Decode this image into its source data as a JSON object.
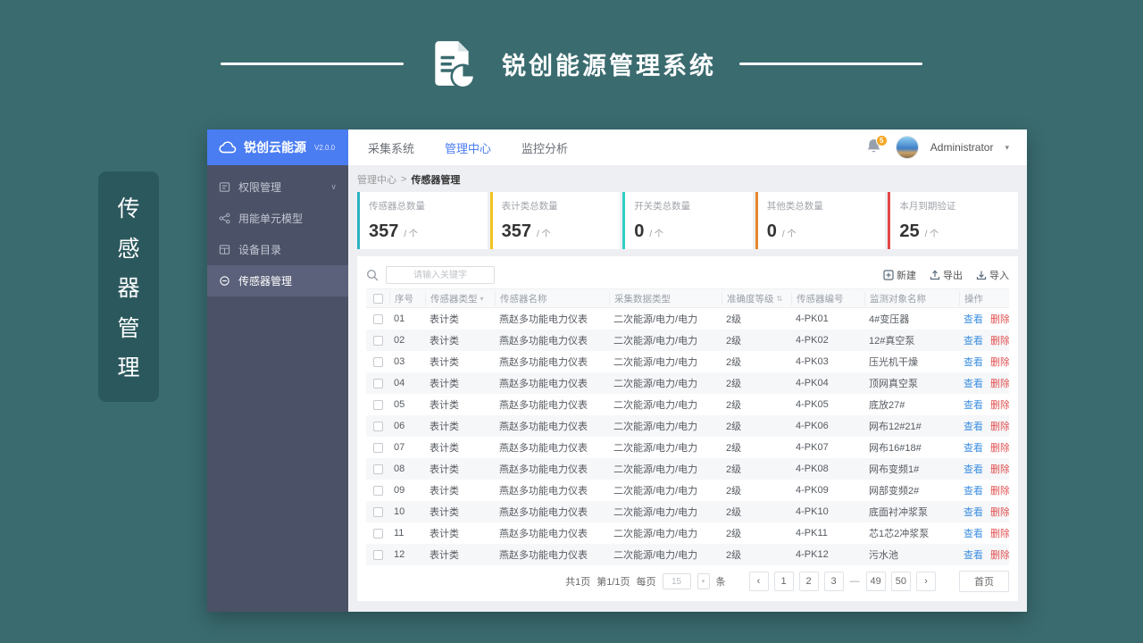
{
  "banner": {
    "title": "锐创能源管理系统"
  },
  "vertical_label": {
    "text": "传感器管理",
    "chars": [
      "传",
      "感",
      "器",
      "管",
      "理"
    ]
  },
  "sidebar": {
    "logo_text": "锐创云能源",
    "version": "V2.0.0",
    "items": [
      {
        "label": "权限管理",
        "active": false,
        "expandable": true
      },
      {
        "label": "用能单元模型",
        "active": false,
        "expandable": false
      },
      {
        "label": "设备目录",
        "active": false,
        "expandable": false
      },
      {
        "label": "传感器管理",
        "active": true,
        "expandable": false
      }
    ]
  },
  "topnav": {
    "items": [
      {
        "label": "采集系统",
        "active": false
      },
      {
        "label": "管理中心",
        "active": true
      },
      {
        "label": "监控分析",
        "active": false
      }
    ],
    "notification_badge": "5",
    "username": "Administrator"
  },
  "breadcrumb": {
    "parent": "管理中心",
    "separator": ">",
    "current": "传感器管理"
  },
  "stats": [
    {
      "label": "传感器总数量",
      "value": "357",
      "unit": "/ 个",
      "color": "#2bb3c0"
    },
    {
      "label": "表计类总数量",
      "value": "357",
      "unit": "/ 个",
      "color": "#f2c41d"
    },
    {
      "label": "开关类总数量",
      "value": "0",
      "unit": "/ 个",
      "color": "#2fd0c6"
    },
    {
      "label": "其他类总数量",
      "value": "0",
      "unit": "/ 个",
      "color": "#e6882e"
    },
    {
      "label": "本月到期验证",
      "value": "25",
      "unit": "/ 个",
      "color": "#e14848"
    }
  ],
  "toolbar": {
    "search_placeholder": "请输入关键字",
    "new_label": "新建",
    "export_label": "导出",
    "import_label": "导入"
  },
  "table": {
    "columns": [
      {
        "label": "序号"
      },
      {
        "label": "传感器类型",
        "icon": "filter"
      },
      {
        "label": "传感器名称"
      },
      {
        "label": "采集数据类型"
      },
      {
        "label": "准确度等级",
        "icon": "sort"
      },
      {
        "label": "传感器编号"
      },
      {
        "label": "监测对象名称"
      },
      {
        "label": "操作"
      }
    ],
    "actions": {
      "view": "查看",
      "delete": "删除"
    },
    "rows": [
      {
        "no": "01",
        "type": "表计类",
        "name": "燕赵多功能电力仪表",
        "data_type": "二次能源/电力/电力",
        "accuracy": "2级",
        "code": "4-PK01",
        "target": "4#变压器"
      },
      {
        "no": "02",
        "type": "表计类",
        "name": "燕赵多功能电力仪表",
        "data_type": "二次能源/电力/电力",
        "accuracy": "2级",
        "code": "4-PK02",
        "target": "12#真空泵"
      },
      {
        "no": "03",
        "type": "表计类",
        "name": "燕赵多功能电力仪表",
        "data_type": "二次能源/电力/电力",
        "accuracy": "2级",
        "code": "4-PK03",
        "target": "压光机干燥"
      },
      {
        "no": "04",
        "type": "表计类",
        "name": "燕赵多功能电力仪表",
        "data_type": "二次能源/电力/电力",
        "accuracy": "2级",
        "code": "4-PK04",
        "target": "顶网真空泵"
      },
      {
        "no": "05",
        "type": "表计类",
        "name": "燕赵多功能电力仪表",
        "data_type": "二次能源/电力/电力",
        "accuracy": "2级",
        "code": "4-PK05",
        "target": "底放27#"
      },
      {
        "no": "06",
        "type": "表计类",
        "name": "燕赵多功能电力仪表",
        "data_type": "二次能源/电力/电力",
        "accuracy": "2级",
        "code": "4-PK06",
        "target": "网布12#21#"
      },
      {
        "no": "07",
        "type": "表计类",
        "name": "燕赵多功能电力仪表",
        "data_type": "二次能源/电力/电力",
        "accuracy": "2级",
        "code": "4-PK07",
        "target": "网布16#18#"
      },
      {
        "no": "08",
        "type": "表计类",
        "name": "燕赵多功能电力仪表",
        "data_type": "二次能源/电力/电力",
        "accuracy": "2级",
        "code": "4-PK08",
        "target": "网布变频1#"
      },
      {
        "no": "09",
        "type": "表计类",
        "name": "燕赵多功能电力仪表",
        "data_type": "二次能源/电力/电力",
        "accuracy": "2级",
        "code": "4-PK09",
        "target": "网部变频2#"
      },
      {
        "no": "10",
        "type": "表计类",
        "name": "燕赵多功能电力仪表",
        "data_type": "二次能源/电力/电力",
        "accuracy": "2级",
        "code": "4-PK10",
        "target": "底面衬冲浆泵"
      },
      {
        "no": "11",
        "type": "表计类",
        "name": "燕赵多功能电力仪表",
        "data_type": "二次能源/电力/电力",
        "accuracy": "2级",
        "code": "4-PK11",
        "target": "芯1芯2冲浆泵"
      },
      {
        "no": "12",
        "type": "表计类",
        "name": "燕赵多功能电力仪表",
        "data_type": "二次能源/电力/电力",
        "accuracy": "2级",
        "code": "4-PK12",
        "target": "污水池"
      }
    ]
  },
  "pagination": {
    "total_pages": "共1页",
    "page_info": "第1/1页",
    "per_page_label": "每页",
    "per_page_value": "15",
    "unit_label": "条",
    "prev": "‹",
    "next": "›",
    "pages": [
      "1",
      "2",
      "3",
      "-",
      "49",
      "50"
    ],
    "home_label": "首页"
  },
  "icons": {
    "chevron_down": "∨",
    "caret_down": "▾",
    "filter": "▾",
    "sort": "⇅",
    "ellipsis": "—"
  }
}
